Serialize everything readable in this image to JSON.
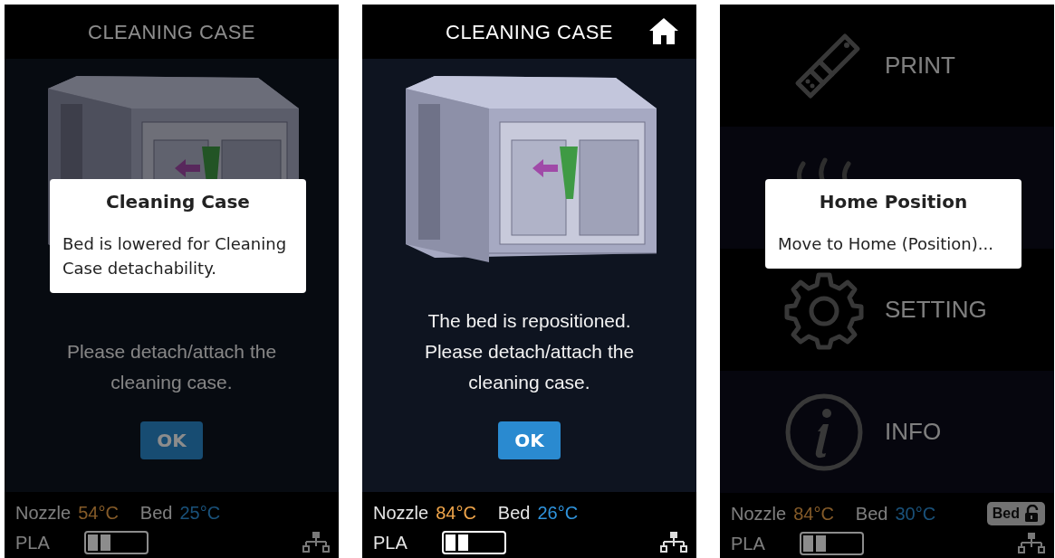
{
  "screens": [
    {
      "kind": "instruction",
      "dimmed": true,
      "title": "CLEANING CASE",
      "message_lines": [
        "Please detach/attach the",
        "cleaning case."
      ],
      "button": "OK",
      "status": {
        "nozzle_label": "Nozzle",
        "nozzle_temp": "54°C",
        "bed_label": "Bed",
        "bed_temp": "25°C",
        "material": "PLA",
        "level": 0.4
      },
      "dialog": {
        "title": "Cleaning Case",
        "body": "Bed is lowered for Cleaning Case detachability."
      }
    },
    {
      "kind": "instruction",
      "dimmed": false,
      "title": "CLEANING CASE",
      "home_button": true,
      "message_lines": [
        "The bed is repositioned.",
        "Please detach/attach the",
        "cleaning case."
      ],
      "button": "OK",
      "status": {
        "nozzle_label": "Nozzle",
        "nozzle_temp": "84°C",
        "bed_label": "Bed",
        "bed_temp": "26°C",
        "material": "PLA",
        "level": 0.4
      }
    },
    {
      "kind": "menu",
      "dimmed": true,
      "menu": [
        {
          "kind": "print",
          "label": "PRINT"
        },
        {
          "kind": "heat"
        },
        {
          "kind": "setting",
          "label": "SETTING"
        },
        {
          "kind": "info",
          "label": "INFO"
        }
      ],
      "status": {
        "nozzle_label": "Nozzle",
        "nozzle_temp": "84°C",
        "bed_label": "Bed",
        "bed_temp": "30°C",
        "material": "PLA",
        "level": 0.4,
        "bed_lock": {
          "label": "Bed",
          "locked": false
        }
      },
      "dialog": {
        "title": "Home Position",
        "body": "Move to Home (Position)..."
      }
    }
  ]
}
